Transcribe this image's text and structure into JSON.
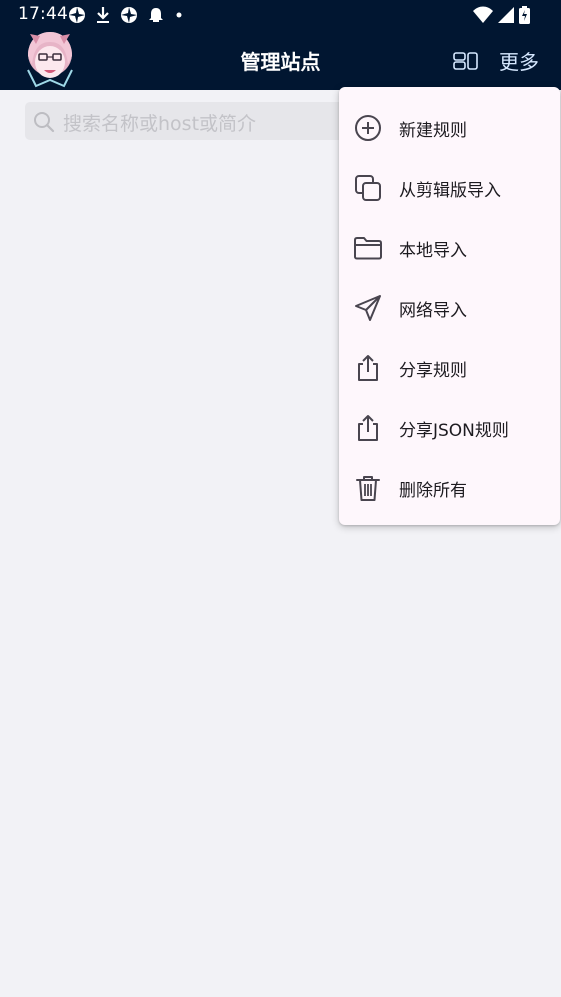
{
  "status": {
    "time": "17:44"
  },
  "header": {
    "title": "管理站点",
    "more_label": "更多"
  },
  "search": {
    "placeholder": "搜索名称或host或简介"
  },
  "menu": {
    "items": [
      {
        "label": "新建规则",
        "icon": "add-circle-icon"
      },
      {
        "label": "从剪辑版导入",
        "icon": "copy-icon"
      },
      {
        "label": "本地导入",
        "icon": "folder-icon"
      },
      {
        "label": "网络导入",
        "icon": "send-icon"
      },
      {
        "label": "分享规则",
        "icon": "share-icon"
      },
      {
        "label": "分享JSON规则",
        "icon": "share-icon"
      },
      {
        "label": "删除所有",
        "icon": "trash-icon"
      }
    ]
  },
  "colors": {
    "appbar": "#011631",
    "background": "#f2f2f6",
    "menu_background": "#fef7fc",
    "search_background": "#e6e6ea"
  }
}
